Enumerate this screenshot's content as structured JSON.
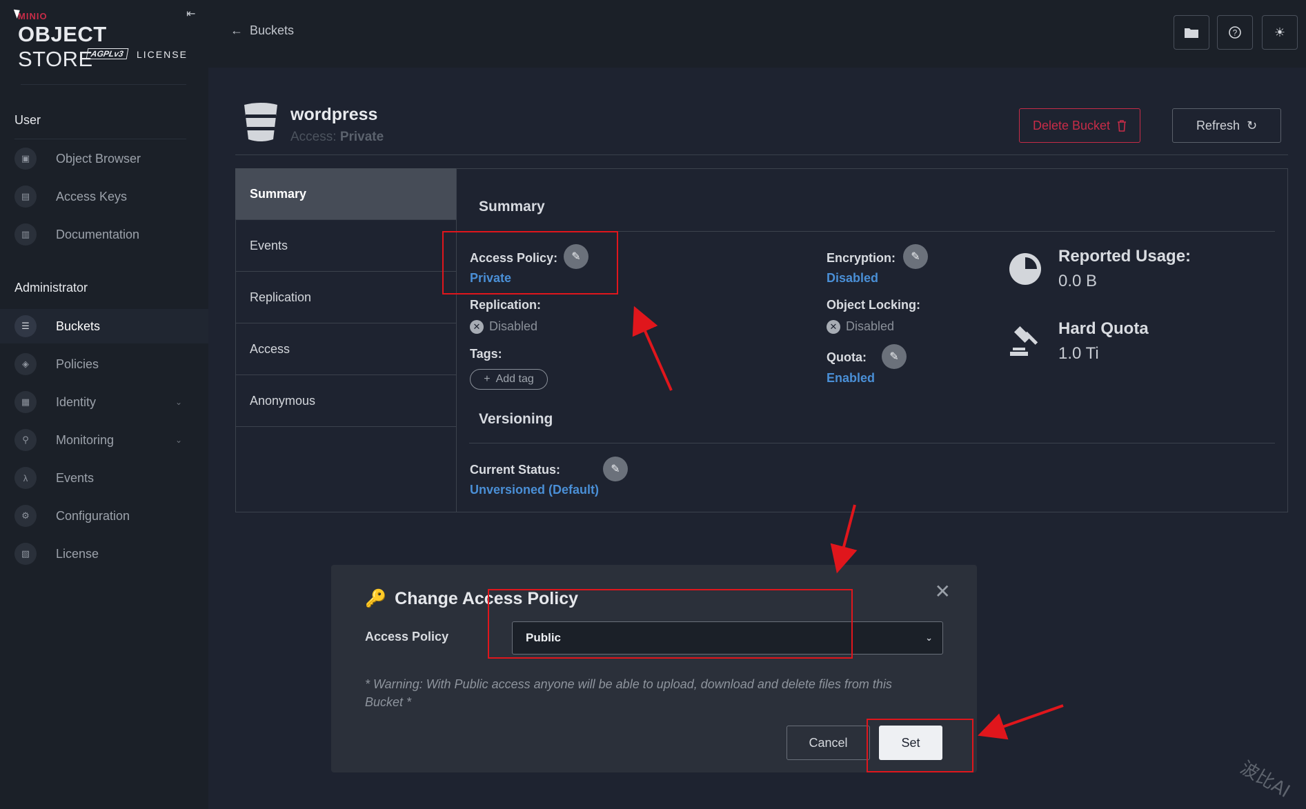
{
  "sidebar": {
    "logo": {
      "brand": "MINIO",
      "product_bold": "OBJECT",
      "product_light": " STORE",
      "badge": "AGPLv3",
      "license": "LICENSE"
    },
    "user_section": "User",
    "user_items": [
      {
        "label": "Object Browser",
        "icon": "object-browser-icon"
      },
      {
        "label": "Access Keys",
        "icon": "access-keys-icon"
      },
      {
        "label": "Documentation",
        "icon": "documentation-icon"
      }
    ],
    "admin_section": "Administrator",
    "admin_items": [
      {
        "label": "Buckets",
        "icon": "bucket-icon",
        "active": true
      },
      {
        "label": "Policies",
        "icon": "shield-icon"
      },
      {
        "label": "Identity",
        "icon": "identity-icon",
        "expandable": true
      },
      {
        "label": "Monitoring",
        "icon": "search-icon",
        "expandable": true
      },
      {
        "label": "Events",
        "icon": "lambda-icon"
      },
      {
        "label": "Configuration",
        "icon": "gear-icon"
      },
      {
        "label": "License",
        "icon": "license-icon"
      }
    ]
  },
  "topbar": {
    "back_label": "Buckets",
    "back_icon": "arrow-left-icon"
  },
  "header": {
    "bucket_name": "wordpress",
    "access_prefix": "Access: ",
    "access_value": "Private",
    "delete_label": "Delete Bucket",
    "refresh_label": "Refresh"
  },
  "tabs": [
    "Summary",
    "Events",
    "Replication",
    "Access",
    "Anonymous"
  ],
  "summary": {
    "title": "Summary",
    "access_policy_label": "Access Policy:",
    "access_policy_value": "Private",
    "replication_label": "Replication:",
    "replication_value": "Disabled",
    "tags_label": "Tags:",
    "add_tag_label": "Add tag",
    "encryption_label": "Encryption:",
    "encryption_value": "Disabled",
    "object_locking_label": "Object Locking:",
    "object_locking_value": "Disabled",
    "quota_label": "Quota:",
    "quota_value": "Enabled",
    "reported_usage_label": "Reported Usage:",
    "reported_usage_value": "0.0 B",
    "hard_quota_label": "Hard Quota",
    "hard_quota_value": "1.0 Ti"
  },
  "versioning": {
    "title": "Versioning",
    "current_status_label": "Current Status:",
    "current_status_value": "Unversioned (Default)"
  },
  "modal": {
    "title": "Change Access Policy",
    "field_label": "Access Policy",
    "selected_value": "Public",
    "warning": "* Warning: With Public access anyone will be able to upload, download and delete files from this Bucket *",
    "cancel_label": "Cancel",
    "set_label": "Set"
  },
  "watermark": "波比AI",
  "colors": {
    "accent_red": "#c72c48",
    "link_blue": "#4a8fd6",
    "annotation_red": "#e0161c"
  }
}
